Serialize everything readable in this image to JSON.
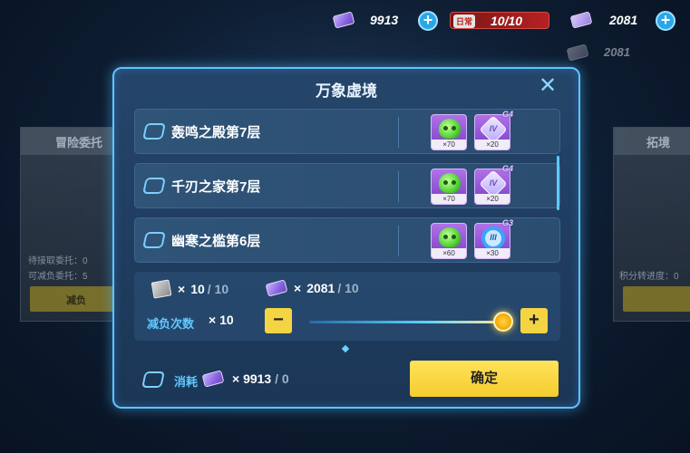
{
  "topbar": {
    "ticket_count": "9913",
    "stamina_tag": "日常",
    "stamina": "10/10",
    "crystal_count": "2081",
    "crystal_count_secondary": "2081"
  },
  "background": {
    "left_card_title": "冒险委托",
    "left_card_line1": "待接取委托：0",
    "left_card_line2": "可减负委托：5",
    "left_card_button": "减负",
    "right_card_title": "拓境",
    "right_card_line1": "积分转进度：0"
  },
  "modal": {
    "title": "万象虚境",
    "close_label": "✕",
    "stages": [
      {
        "name": "轰鸣之殿第7层",
        "rewards": [
          {
            "icon": "green-skull-material-icon",
            "qty": "×70"
          },
          {
            "icon": "iv-crystal-icon",
            "grade": "G4",
            "label": "IV",
            "qty": "×20"
          }
        ]
      },
      {
        "name": "千刃之家第7层",
        "rewards": [
          {
            "icon": "green-skull-material-icon",
            "qty": "×70"
          },
          {
            "icon": "iv-crystal-icon",
            "grade": "G4",
            "label": "IV",
            "qty": "×20"
          }
        ]
      },
      {
        "name": "幽寒之槛第6层",
        "rewards": [
          {
            "icon": "green-skull-material-icon",
            "qty": "×60"
          },
          {
            "icon": "iii-ring-icon",
            "grade": "G3",
            "label": "III",
            "qty": "×30"
          }
        ]
      }
    ],
    "summary": {
      "ticket_count": "10",
      "ticket_total": "/ 10",
      "crystal_count": "2081",
      "crystal_total": "/ 10",
      "times_label": "减负次数",
      "times_value": "× 10",
      "slider_fraction": 1.0,
      "minus_label": "−",
      "plus_label": "+"
    },
    "footer": {
      "consume_label": "消耗",
      "consume_value": "9913",
      "consume_total": "/ 0",
      "confirm_label": "确定"
    }
  },
  "colors": {
    "accent": "#5fc4ff",
    "button_yellow": "#f5d443",
    "label_blue": "#60c8ff"
  }
}
